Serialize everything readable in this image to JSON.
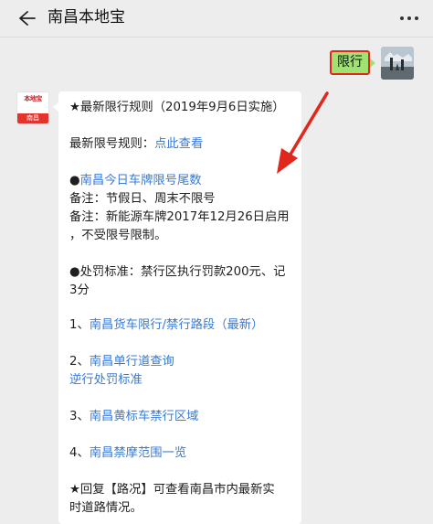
{
  "header": {
    "title": "南昌本地宝"
  },
  "outgoing": {
    "text": "限行"
  },
  "bot_avatar": {
    "top_text": "本地宝",
    "bottom_text": "南昌"
  },
  "message": {
    "l1": "★最新限行规则（2019年9月6日实施）",
    "l2_prefix": "最新限号规则：",
    "l2_link": "点此查看",
    "l3_bullet": "●",
    "l3_link": "南昌今日车牌限号尾数",
    "l4": "备注：节假日、周末不限号",
    "l5": "备注：新能源车牌2017年12月26日启用",
    "l6": "，不受限号限制。",
    "l7": "●处罚标准：禁行区执行罚款200元、记",
    "l8": "3分",
    "i1_num": "1、",
    "i1_link": "南昌货车限行/禁行路段（最新）",
    "i2_num": "2、",
    "i2_link": "南昌单行道查询",
    "i2_link2": "逆行处罚标准",
    "i3_num": "3、",
    "i3_link": "南昌黄标车禁行区域",
    "i4_num": "4、",
    "i4_link": "南昌禁摩范围一览",
    "l_end1": "★回复【路况】可查看南昌市内最新实",
    "l_end2": "时道路情况。"
  },
  "colors": {
    "link": "#3a7bd5",
    "outgoing_bubble": "#9fe271",
    "highlight": "#e1261c",
    "arrow": "#e1261c"
  },
  "icons": {
    "back": "arrow-left-icon",
    "more": "more-dots-icon"
  }
}
